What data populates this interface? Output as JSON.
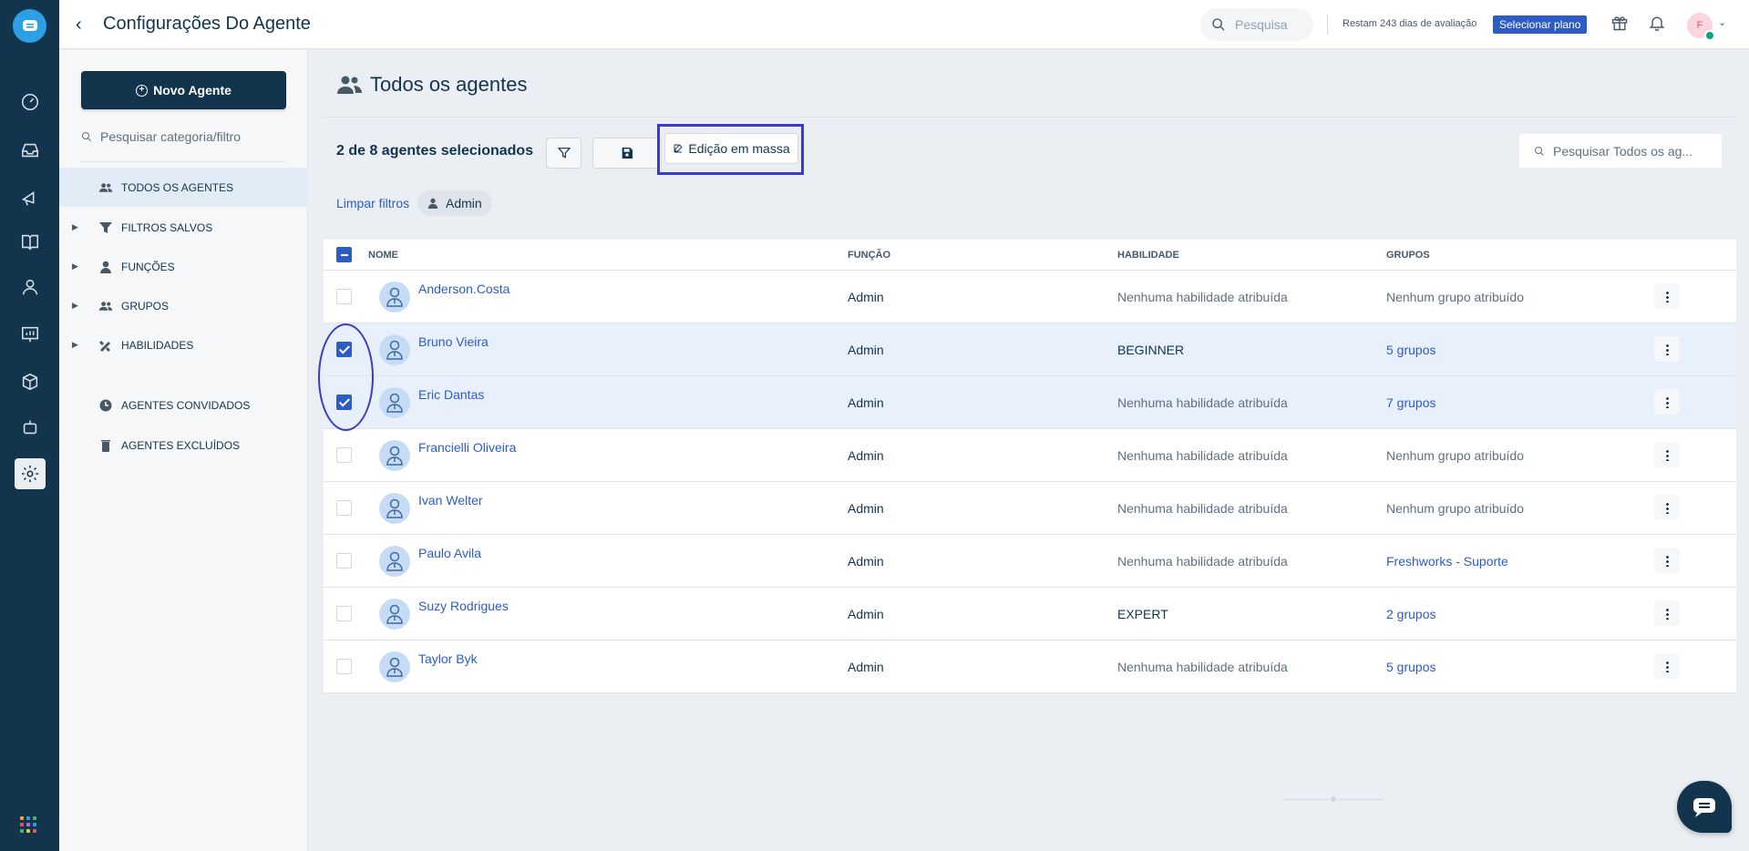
{
  "header": {
    "title": "Configurações Do Agente",
    "search_placeholder": "Pesquisa",
    "trial_text": "Restam 243 dias de avaliação",
    "plan_button": "Selecionar plano",
    "avatar_initial": "F"
  },
  "sidebar": {
    "new_agent_label": "Novo Agente",
    "search_placeholder": "Pesquisar categoria/filtro",
    "items": [
      {
        "label": "TODOS OS AGENTES",
        "icon": "users-icon",
        "expandable": false,
        "active": true
      },
      {
        "label": "FILTROS SALVOS",
        "icon": "filter-icon",
        "expandable": true,
        "active": false
      },
      {
        "label": "FUNÇÕES",
        "icon": "user-icon",
        "expandable": true,
        "active": false
      },
      {
        "label": "GRUPOS",
        "icon": "users-icon",
        "expandable": true,
        "active": false
      },
      {
        "label": "HABILIDADES",
        "icon": "tools-icon",
        "expandable": true,
        "active": false
      },
      {
        "label": "AGENTES CONVIDADOS",
        "icon": "clock-icon",
        "expandable": false,
        "active": false
      },
      {
        "label": "AGENTES EXCLUÍDOS",
        "icon": "trash-icon",
        "expandable": false,
        "active": false
      }
    ]
  },
  "main": {
    "page_title": "Todos os agentes",
    "selection_count": "2 de 8 agentes selecionados",
    "bulk_edit_label": "Edição em massa",
    "search_placeholder": "Pesquisar Todos os ag...",
    "clear_filters": "Limpar filtros",
    "filter_chip": "Admin",
    "columns": [
      "NOME",
      "FUNÇÃO",
      "HABILIDADE",
      "GRUPOS"
    ],
    "rows": [
      {
        "name": "Anderson.Costa",
        "role": "Admin",
        "skill": "Nenhuma habilidade atribuída",
        "groups": "Nenhum grupo atribuído",
        "selected": false
      },
      {
        "name": "Bruno Vieira",
        "role": "Admin",
        "skill": "BEGINNER",
        "groups": "5 grupos",
        "selected": true
      },
      {
        "name": "Eric Dantas",
        "role": "Admin",
        "skill": "Nenhuma habilidade atribuída",
        "groups": "7 grupos",
        "selected": true
      },
      {
        "name": "Francielli Oliveira",
        "role": "Admin",
        "skill": "Nenhuma habilidade atribuída",
        "groups": "Nenhum grupo atribuído",
        "selected": false
      },
      {
        "name": "Ivan Welter",
        "role": "Admin",
        "skill": "Nenhuma habilidade atribuída",
        "groups": "Nenhum grupo atribuído",
        "selected": false
      },
      {
        "name": "Paulo Avila",
        "role": "Admin",
        "skill": "Nenhuma habilidade atribuída",
        "groups": "Freshworks - Suporte",
        "selected": false
      },
      {
        "name": "Suzy Rodrigues",
        "role": "Admin",
        "skill": "EXPERT",
        "groups": "2 grupos",
        "selected": false
      },
      {
        "name": "Taylor Byk",
        "role": "Admin",
        "skill": "Nenhuma habilidade atribuída",
        "groups": "5 grupos",
        "selected": false
      }
    ]
  },
  "colors": {
    "rail": "#12344d",
    "accent": "#2c5cc5",
    "annotation": "#3b3bc4",
    "selected_row": "#e8f1fb"
  }
}
